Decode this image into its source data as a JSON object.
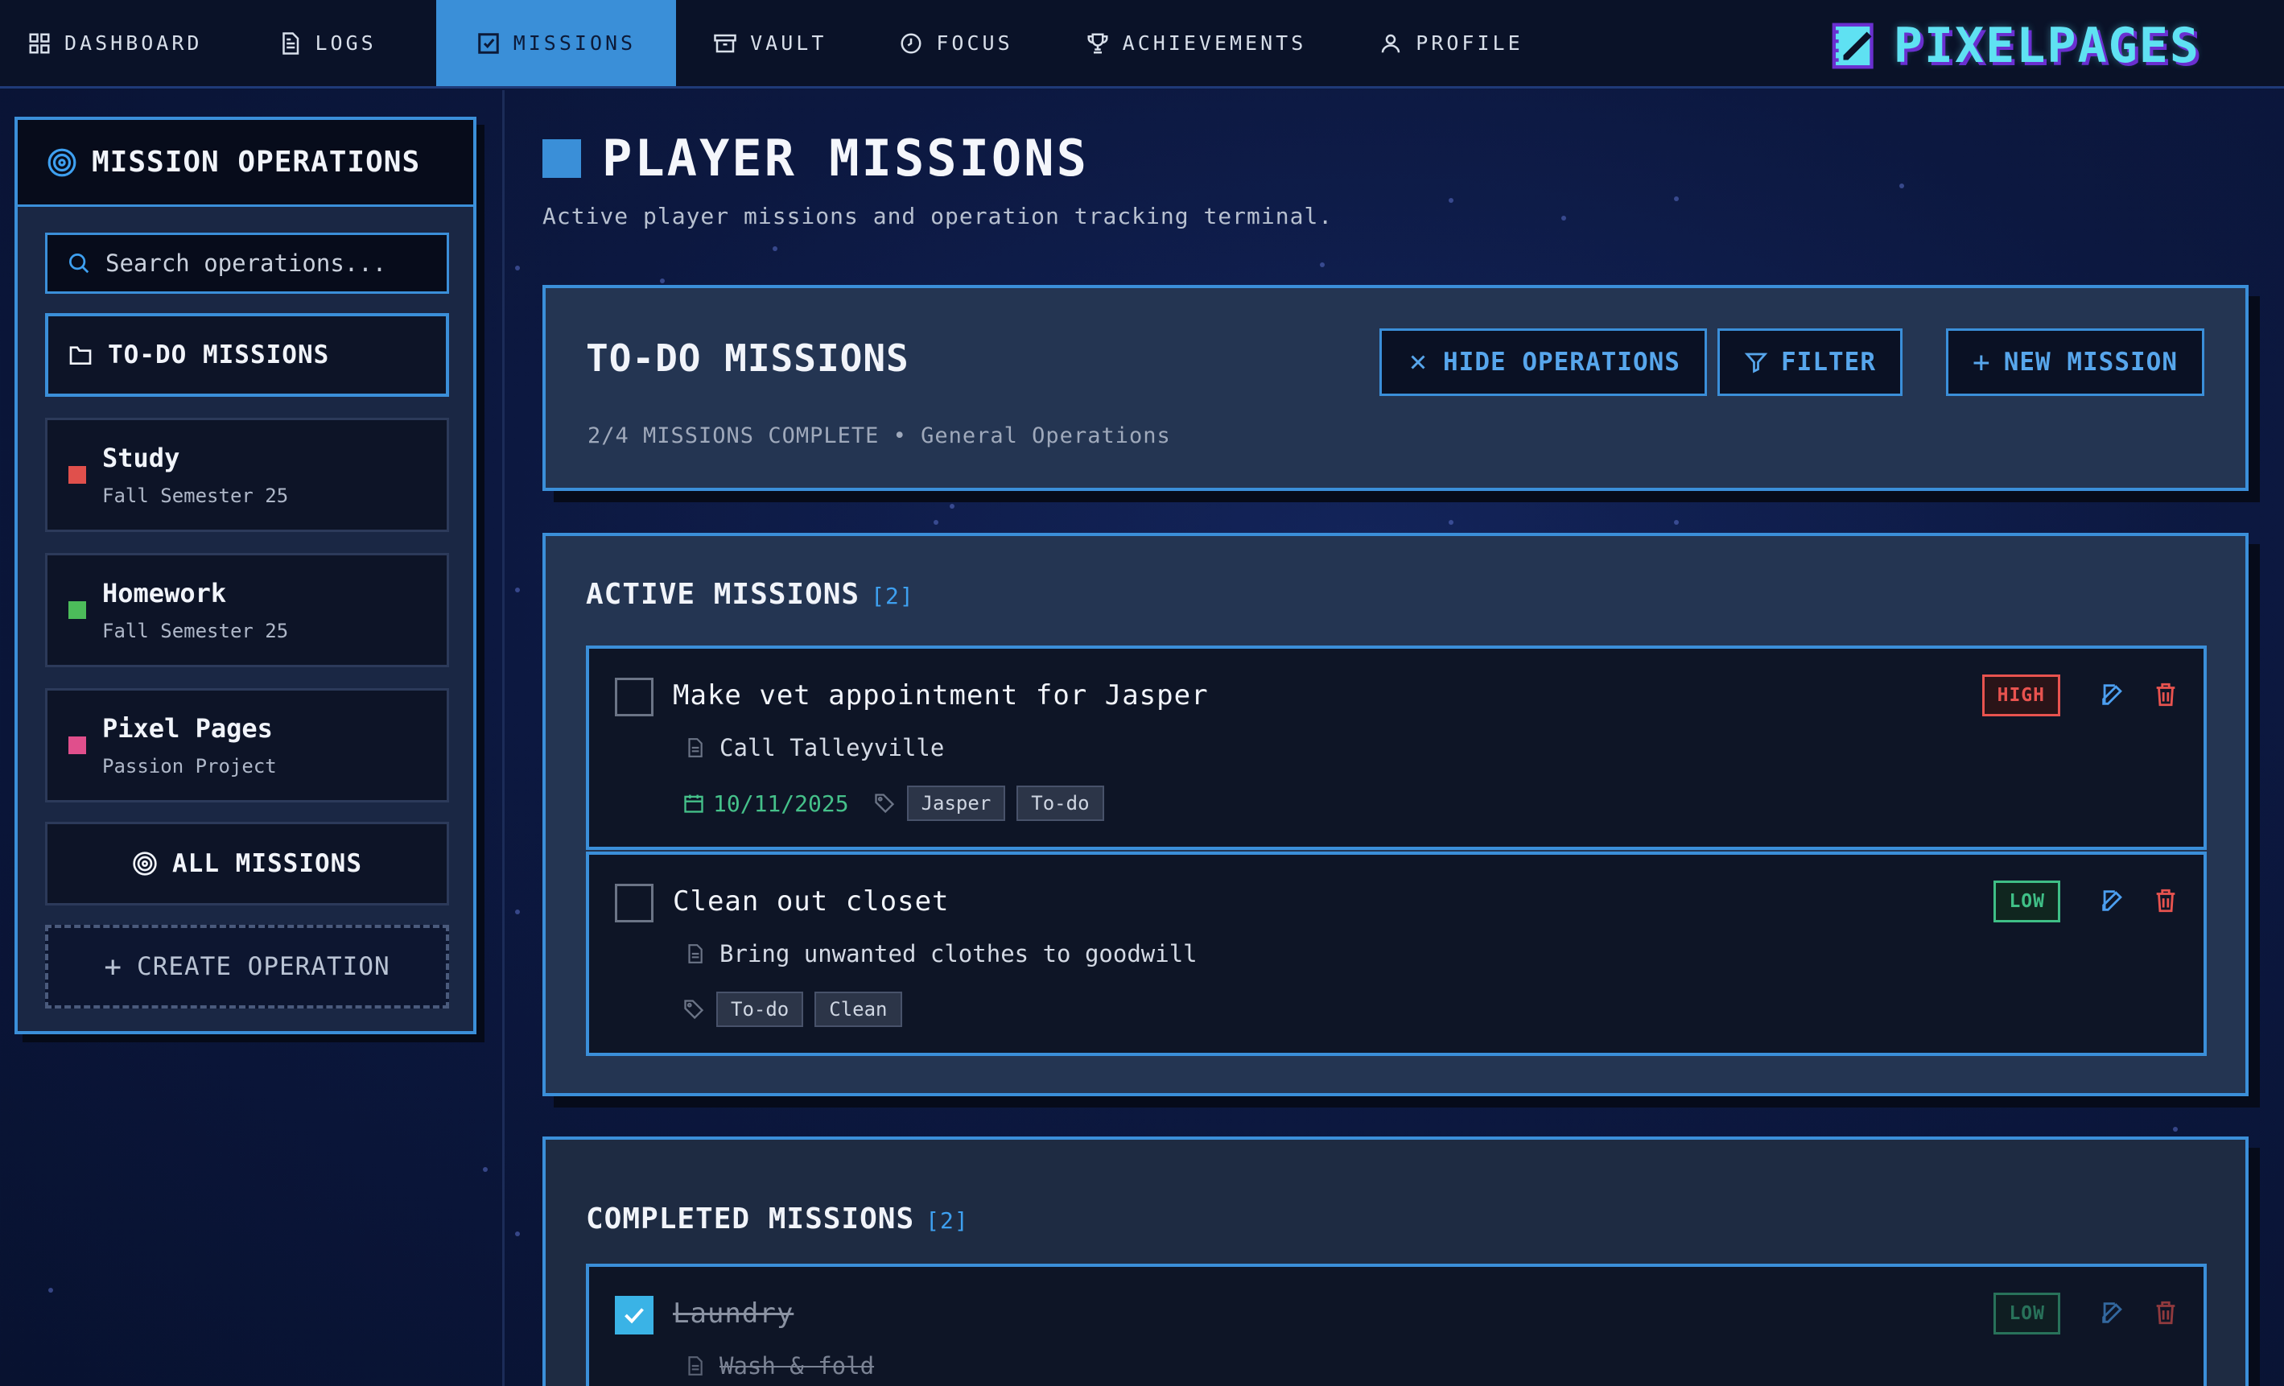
{
  "nav": {
    "items": [
      {
        "label": "DASHBOARD",
        "icon": "grid-icon"
      },
      {
        "label": "LOGS",
        "icon": "document-icon"
      },
      {
        "label": "MISSIONS",
        "icon": "checkbox-icon",
        "active": true
      },
      {
        "label": "VAULT",
        "icon": "archive-icon"
      },
      {
        "label": "FOCUS",
        "icon": "clock-icon"
      },
      {
        "label": "ACHIEVEMENTS",
        "icon": "trophy-icon"
      },
      {
        "label": "PROFILE",
        "icon": "user-icon"
      }
    ],
    "logo_text": "PIXELPAGES"
  },
  "sidebar": {
    "title": "MISSION OPERATIONS",
    "search_placeholder": "Search operations...",
    "todo_label": "TO-DO MISSIONS",
    "projects": [
      {
        "name": "Study",
        "subtitle": "Fall Semester 25",
        "color": "#e0504c"
      },
      {
        "name": "Homework",
        "subtitle": "Fall Semester 25",
        "color": "#4cbc5a"
      },
      {
        "name": "Pixel Pages",
        "subtitle": "Passion Project",
        "color": "#e04f8c"
      }
    ],
    "all_missions_label": "ALL MISSIONS",
    "create_label": "CREATE OPERATION"
  },
  "main": {
    "title": "PLAYER MISSIONS",
    "subtitle": "Active player missions and operation tracking terminal.",
    "todo": {
      "title": "TO-DO MISSIONS",
      "meta": "2/4 MISSIONS COMPLETE • General Operations",
      "hide_label": "HIDE OPERATIONS",
      "filter_label": "FILTER",
      "new_label": "NEW MISSION"
    },
    "active": {
      "title": "ACTIVE MISSIONS",
      "count": "[2]",
      "tasks": [
        {
          "title": "Make vet appointment for Jasper",
          "description": "Call Talleyville",
          "date": "10/11/2025",
          "tags": [
            "Jasper",
            "To-do"
          ],
          "priority": "HIGH"
        },
        {
          "title": "Clean out closet",
          "description": "Bring unwanted clothes to goodwill",
          "tags": [
            "To-do",
            "Clean"
          ],
          "priority": "LOW"
        }
      ]
    },
    "completed": {
      "title": "COMPLETED MISSIONS",
      "count": "[2]",
      "tasks": [
        {
          "title": "Laundry",
          "description": "Wash & fold",
          "priority": "LOW"
        }
      ]
    }
  },
  "colors": {
    "accent": "#3b8fd9",
    "high": "#e8534f",
    "low": "#3fbf86",
    "date": "#45c18a"
  }
}
